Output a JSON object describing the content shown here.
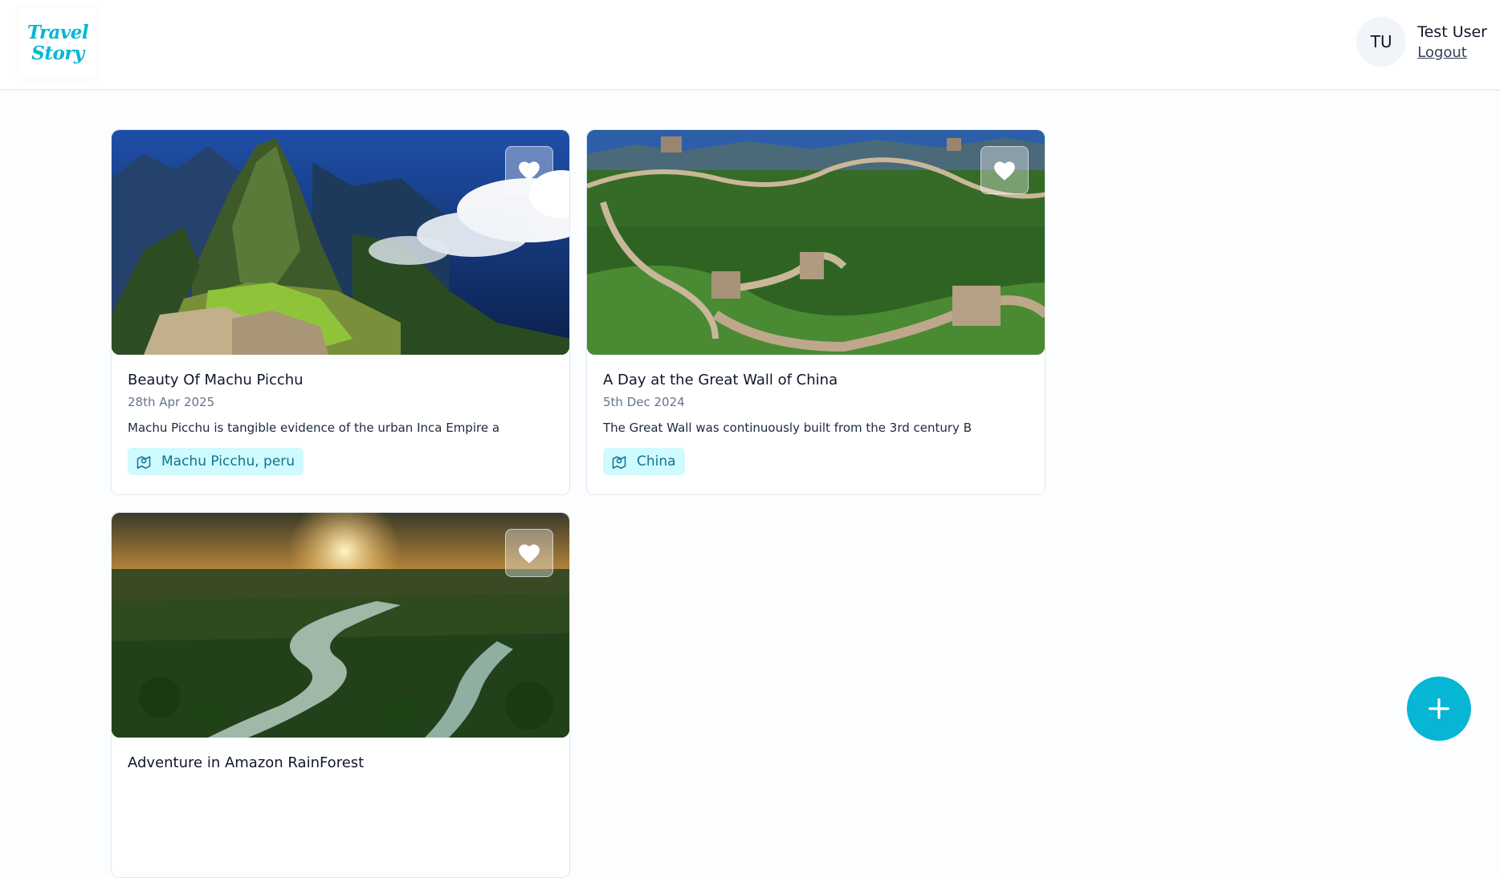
{
  "logo": {
    "line1": "Travel",
    "line2": "Story"
  },
  "user": {
    "initials": "TU",
    "name": "Test User",
    "logout_label": "Logout"
  },
  "stories": [
    {
      "title": "Beauty Of Machu Picchu",
      "date": "28th Apr 2025",
      "description": "Machu Picchu is tangible evidence of the urban Inca Empire a",
      "location": "Machu Picchu, peru"
    },
    {
      "title": "A Day at the Great Wall of China",
      "date": "5th Dec 2024",
      "description": "The Great Wall was continuously built from the 3rd century B",
      "location": "China"
    },
    {
      "title": "Adventure in Amazon RainForest"
    }
  ],
  "icons": {
    "favorite": "heart-icon",
    "location": "map-pin-icon",
    "add": "plus-icon"
  },
  "colors": {
    "accent": "#06b6d4",
    "badge_bg": "#cffafe",
    "badge_text": "#0e7490"
  }
}
